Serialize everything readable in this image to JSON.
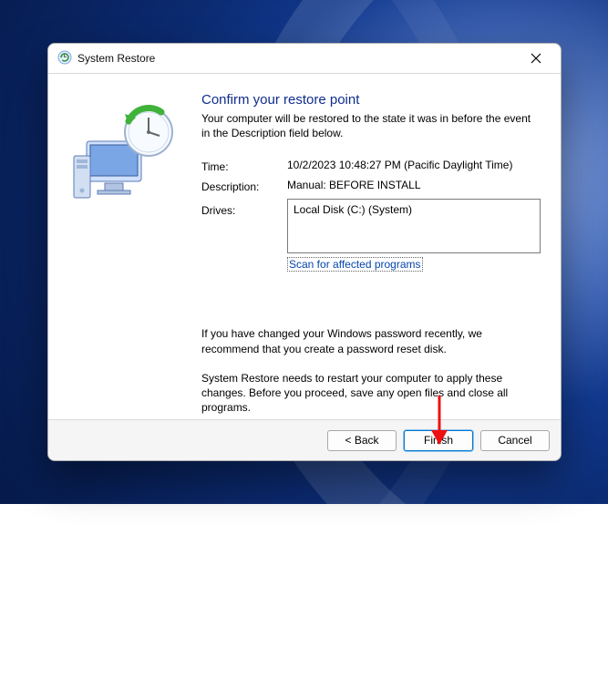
{
  "window": {
    "title": "System Restore"
  },
  "content": {
    "heading": "Confirm your restore point",
    "intro": "Your computer will be restored to the state it was in before the event in the Description field below.",
    "labels": {
      "time": "Time:",
      "description": "Description:",
      "drives": "Drives:"
    },
    "values": {
      "time": "10/2/2023 10:48:27 PM (Pacific Daylight Time)",
      "description": "Manual: BEFORE INSTALL",
      "drive_entry": "Local Disk (C:) (System)"
    },
    "scan_link": "Scan for affected programs",
    "note_password": "If you have changed your Windows password recently, we recommend that you create a password reset disk.",
    "note_restart": "System Restore needs to restart your computer to apply these changes. Before you proceed, save any open files and close all programs."
  },
  "buttons": {
    "back": "< Back",
    "finish": "Finish",
    "cancel": "Cancel"
  }
}
